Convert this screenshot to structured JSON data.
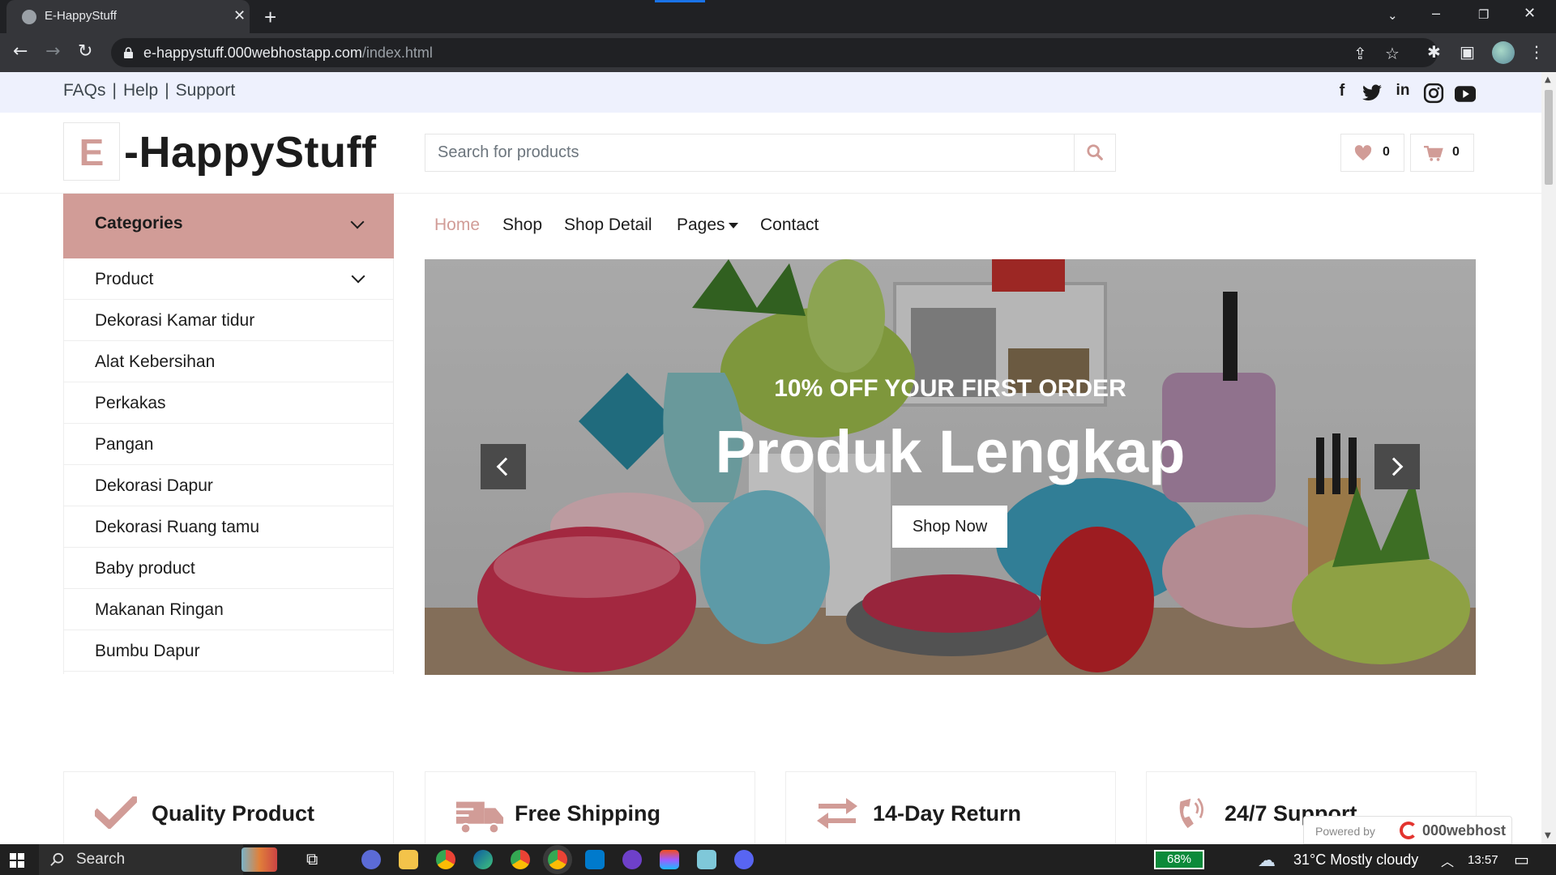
{
  "browser": {
    "tab_title": "E-HappyStuff",
    "url_host": "e-happystuff.000webhostapp.com",
    "url_path": "/index.html"
  },
  "topbar": {
    "links": [
      "FAQs",
      "Help",
      "Support"
    ],
    "social_icons": [
      "facebook-icon",
      "twitter-icon",
      "linkedin-icon",
      "instagram-icon",
      "youtube-icon"
    ]
  },
  "logo": {
    "letter": "E",
    "text": "-HappyStuff"
  },
  "search": {
    "placeholder": "Search for products"
  },
  "header_counts": {
    "wishlist": "0",
    "cart": "0"
  },
  "sidebar": {
    "header": "Categories",
    "items": [
      "Product",
      "Dekorasi Kamar tidur",
      "Alat Kebersihan",
      "Perkakas",
      "Pangan",
      "Dekorasi Dapur",
      "Dekorasi Ruang tamu",
      "Baby product",
      "Makanan Ringan",
      "Bumbu Dapur"
    ]
  },
  "nav": {
    "home": "Home",
    "shop": "Shop",
    "shop_detail": "Shop Detail",
    "pages": "Pages",
    "contact": "Contact"
  },
  "hero": {
    "subtitle": "10% OFF YOUR FIRST ORDER",
    "title": "Produk Lengkap",
    "button": "Shop Now"
  },
  "features": [
    "Quality Product",
    "Free Shipping",
    "14-Day Return",
    "24/7 Support"
  ],
  "hosting_badge": {
    "prefix": "Powered by",
    "brand": "000webhost"
  },
  "taskbar": {
    "search": "Search",
    "battery": "68%",
    "weather": "31°C  Mostly cloudy",
    "time": "13:57"
  },
  "colors": {
    "primary": "#d19c97",
    "topbar_bg": "#eef1fd",
    "dark": "#1c1c1c"
  }
}
